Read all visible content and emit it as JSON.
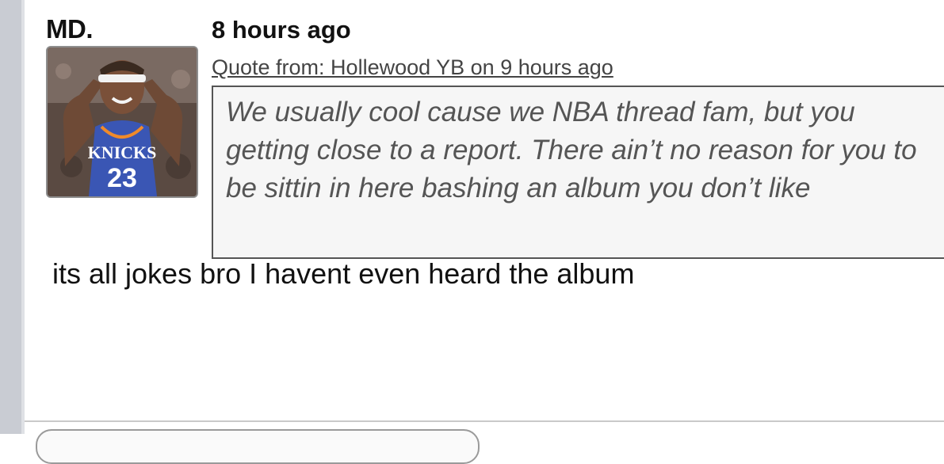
{
  "post": {
    "username": "MD.",
    "timestamp": "8 hours ago",
    "avatar_icon": "player-avatar-icon",
    "quote": {
      "header": "Quote from: Hollewood YB on 9 hours ago",
      "text": "We usually cool cause we NBA thread fam, but you getting close to a report. There ain’t no reason for you to be sittin in here bashing an album you don’t like"
    },
    "message": "its all jokes bro I havent even heard the album"
  },
  "colors": {
    "rail": "#c9ccd3",
    "quote_bg": "#f6f6f6",
    "quote_border": "#555555",
    "text": "#111111"
  }
}
